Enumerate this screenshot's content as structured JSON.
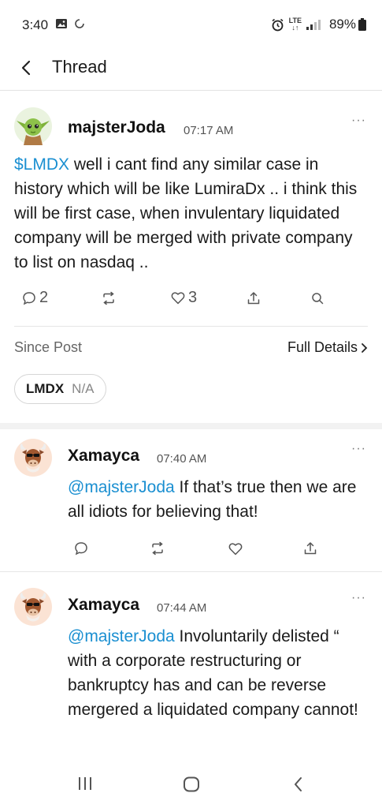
{
  "status_bar": {
    "time": "3:40",
    "network": "LTE",
    "battery": "89%"
  },
  "header": {
    "title": "Thread"
  },
  "main_post": {
    "username": "majsterJoda",
    "time": "07:17 AM",
    "more": "···",
    "cashtag": "$LMDX",
    "text": " well i cant find any similar case in history which will be like LumiraDx .. i think this will be first case, when invulentary liquidated company will be merged with private company to list on nasdaq ..",
    "replies": "2",
    "likes": "3"
  },
  "since_post": {
    "label": "Since Post",
    "full_details": "Full Details",
    "ticker": "LMDX",
    "change": "N/A"
  },
  "replies": [
    {
      "username": "Xamayca",
      "time": "07:40 AM",
      "more": "···",
      "mention": "@majsterJoda",
      "text": " If that’s true then we are all idiots for believing that!"
    },
    {
      "username": "Xamayca",
      "time": "07:44 AM",
      "more": "···",
      "mention": "@majsterJoda",
      "text": " Involuntarily delisted “ with a corporate restructuring or bankruptcy has and can be reverse mergered a liquidated company cannot!"
    }
  ],
  "icons": {
    "back": "chevron-left-icon",
    "reply": "comment-icon",
    "repost": "repost-icon",
    "like": "heart-icon",
    "share": "share-icon",
    "search": "search-icon"
  }
}
